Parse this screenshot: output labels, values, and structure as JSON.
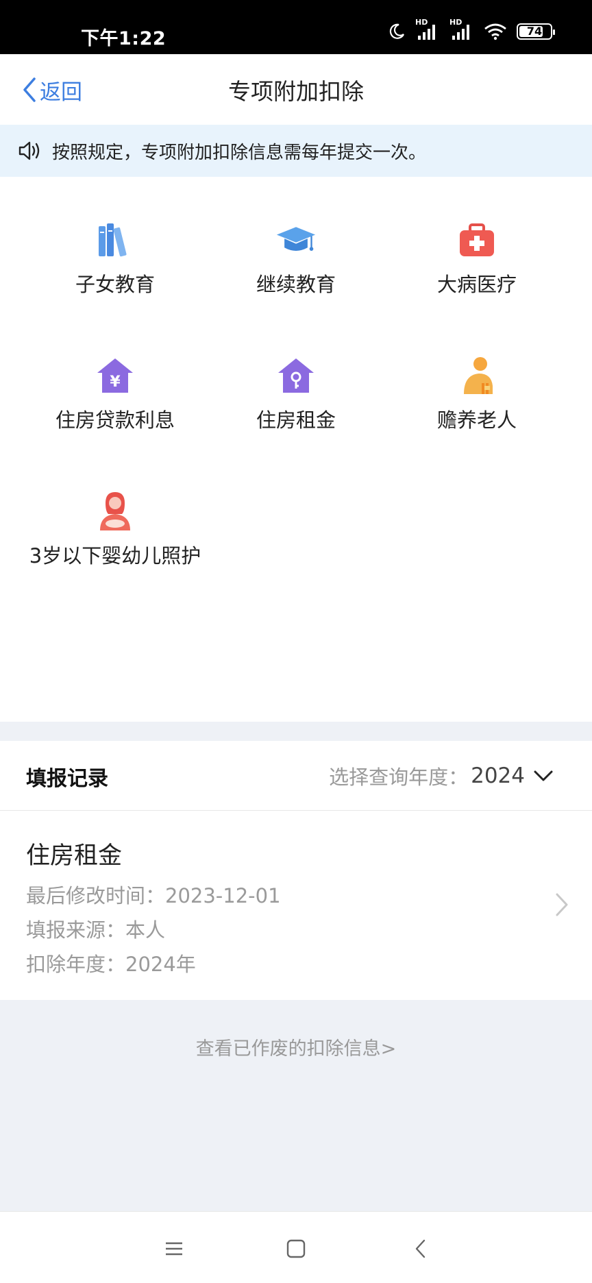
{
  "status_bar": {
    "time": "下午1:22",
    "signal1_label": "HD",
    "signal2_label": "HD",
    "battery": "74",
    "icons": [
      "moon-icon",
      "signal-icon",
      "signal-icon",
      "wifi-icon",
      "battery-icon"
    ]
  },
  "nav": {
    "back_label": "返回",
    "title": "专项附加扣除"
  },
  "notice": {
    "icon": "speaker-icon",
    "text": "按照规定，专项附加扣除信息需每年提交一次。"
  },
  "categories": [
    {
      "label": "子女教育",
      "icon": "books-icon"
    },
    {
      "label": "继续教育",
      "icon": "graduation-cap-icon"
    },
    {
      "label": "大病医疗",
      "icon": "medical-kit-icon"
    },
    {
      "label": "住房贷款利息",
      "icon": "house-yen-icon"
    },
    {
      "label": "住房租金",
      "icon": "house-key-icon"
    },
    {
      "label": "赡养老人",
      "icon": "elderly-person-icon"
    },
    {
      "label": "3岁以下婴幼儿照护",
      "icon": "mother-baby-icon"
    }
  ],
  "records": {
    "title": "填报记录",
    "year_prefix": "选择查询年度：",
    "year": "2024",
    "items": [
      {
        "name": "住房租金",
        "modified": "最后修改时间：2023-12-01",
        "source": "填报来源：本人",
        "deduct_year": "扣除年度：2024年"
      }
    ]
  },
  "void_link": "查看已作废的扣除信息>",
  "colors": {
    "accent": "#3d7ee0",
    "notice_bg": "#e8f3fc",
    "page_bg": "#eef1f6"
  }
}
